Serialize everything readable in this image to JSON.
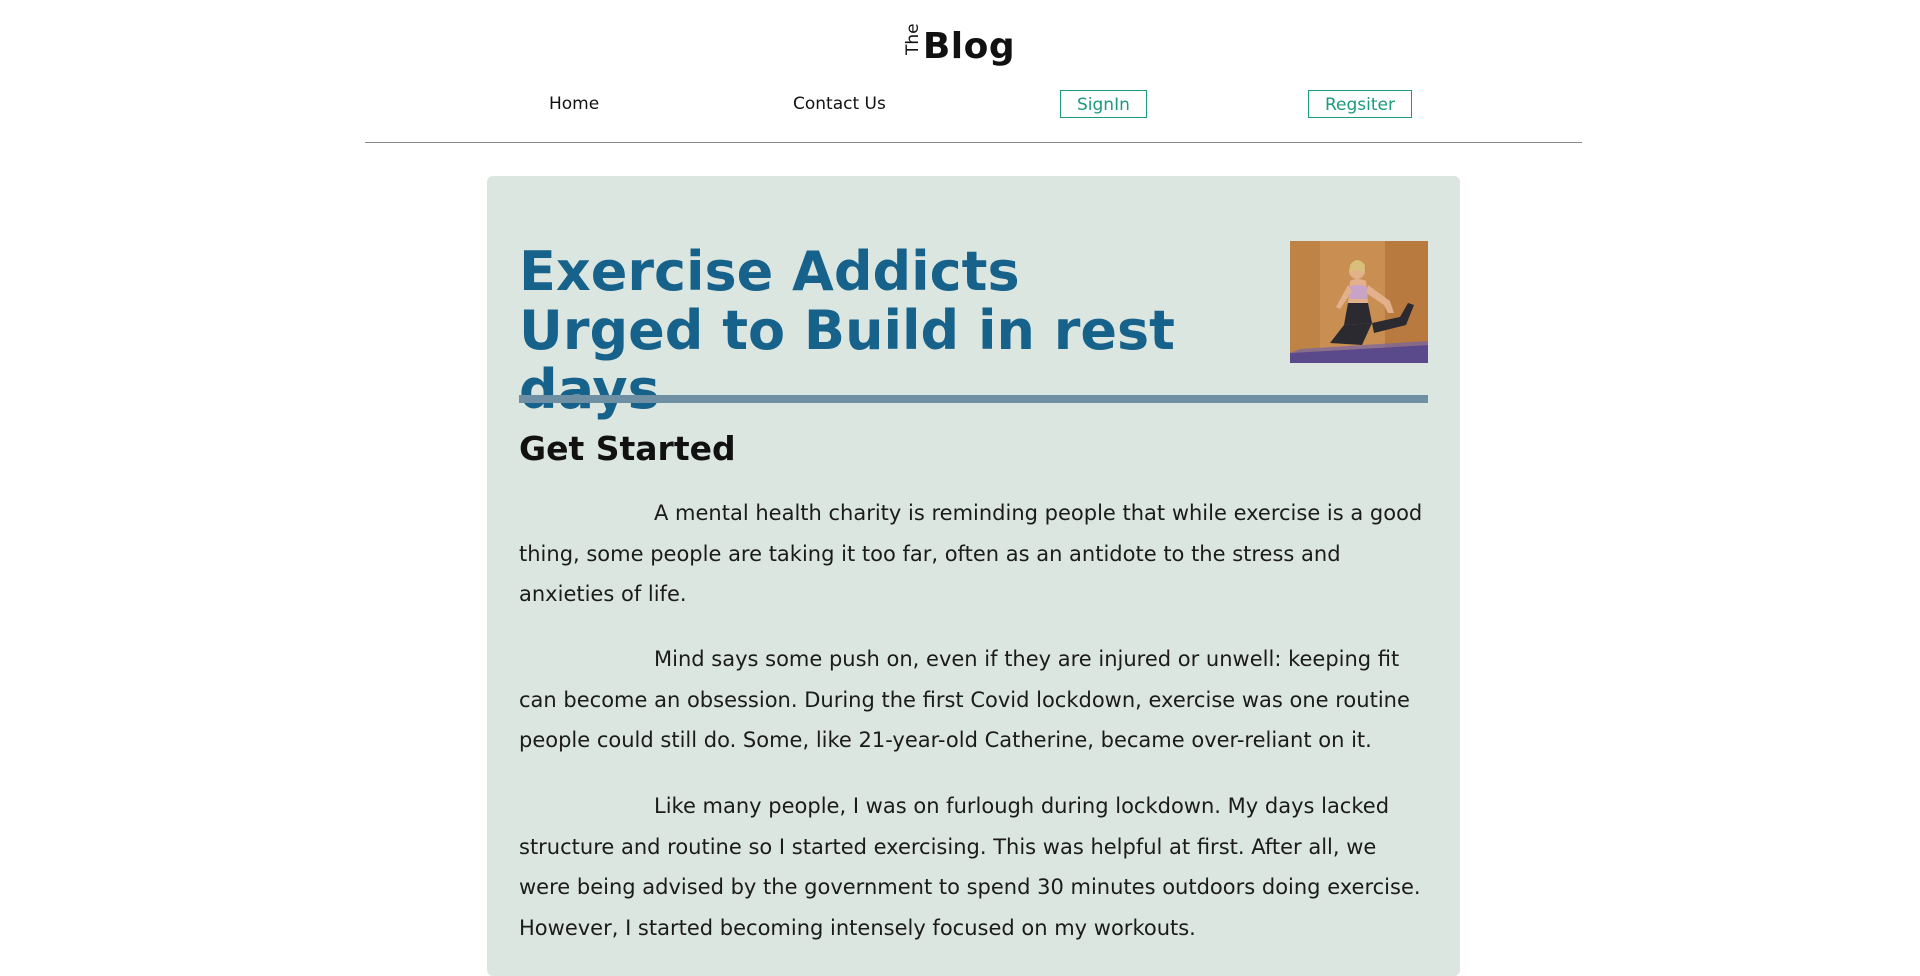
{
  "logo": {
    "small": "The",
    "main": "Blog"
  },
  "nav": {
    "home": "Home",
    "contact": "Contact Us",
    "signin": "SignIn",
    "register": "Regsiter"
  },
  "colors": {
    "accent": "#1a9a7e",
    "title": "#16628a",
    "card_bg": "#dce6e1",
    "rule": "#6f8fa4"
  },
  "article": {
    "title": "Exercise Addicts Urged to Build in rest days",
    "image_alt": "yoga-woman-stretching",
    "section_heading": "Get Started",
    "paragraphs": [
      "A mental health charity is reminding people that while exercise is a good thing, some people are taking it too far, often as an antidote to the stress and anxieties of life.",
      "Mind says some push on, even if they are injured or unwell: keeping fit can become an obsession. During the first Covid lockdown, exercise was one routine people could still do. Some, like 21-year-old Catherine, became over-reliant on it.",
      "Like many people, I was on furlough during lockdown. My days lacked structure and routine so I started exercising. This was helpful at first. After all, we were being advised by the government to spend 30 minutes outdoors doing exercise. However, I started becoming intensely focused on my workouts."
    ]
  }
}
